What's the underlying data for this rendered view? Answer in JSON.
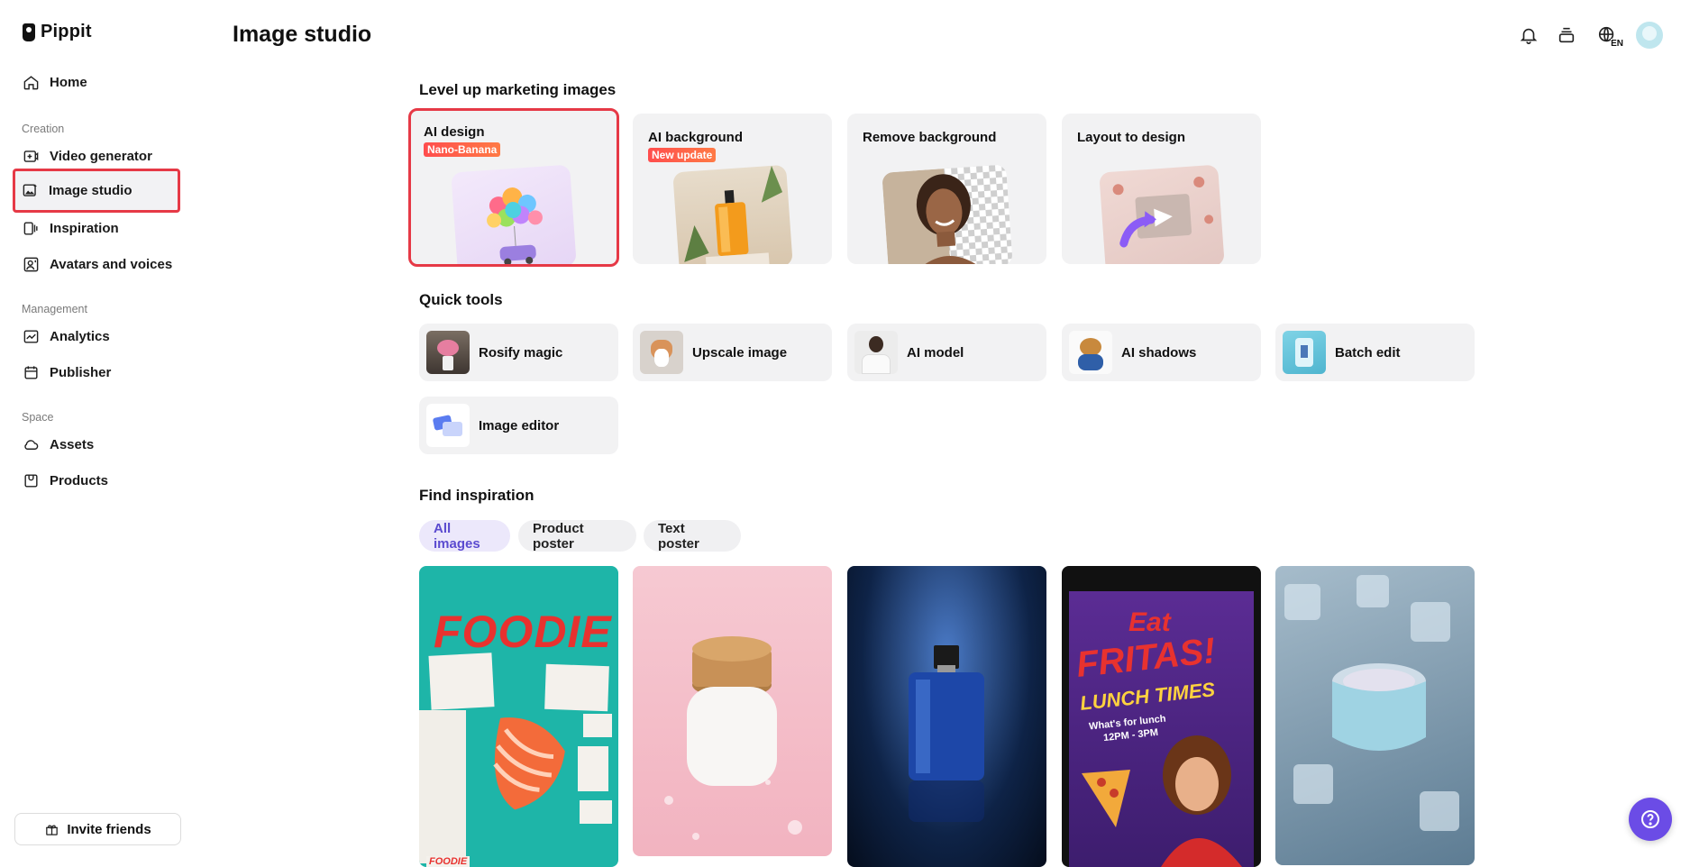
{
  "app": {
    "name": "Pippit",
    "page_title": "Image studio"
  },
  "sidebar": {
    "home": "Home",
    "sections": [
      "Creation",
      "Management",
      "Space"
    ],
    "items": [
      {
        "label": "Video generator"
      },
      {
        "label": "Image studio",
        "active": true
      },
      {
        "label": "Inspiration"
      },
      {
        "label": "Avatars and voices"
      },
      {
        "label": "Analytics"
      },
      {
        "label": "Publisher"
      },
      {
        "label": "Assets"
      },
      {
        "label": "Products"
      }
    ],
    "invite": "Invite friends"
  },
  "header": {
    "language_badge": "EN",
    "icons": [
      "bell-icon",
      "layers-icon",
      "globe-icon",
      "avatar"
    ]
  },
  "marketing": {
    "title": "Level up marketing images",
    "cards": [
      {
        "title": "AI design",
        "badge": "Nano-Banana"
      },
      {
        "title": "AI background",
        "badge": "New update"
      },
      {
        "title": "Remove background"
      },
      {
        "title": "Layout to design"
      }
    ]
  },
  "quick_tools": {
    "title": "Quick tools",
    "items": [
      {
        "label": "Rosify magic"
      },
      {
        "label": "Upscale image"
      },
      {
        "label": "AI model"
      },
      {
        "label": "AI shadows"
      },
      {
        "label": "Batch edit"
      },
      {
        "label": "Image editor"
      }
    ]
  },
  "inspiration": {
    "title": "Find inspiration",
    "filters": [
      "All images",
      "Product poster",
      "Text poster"
    ],
    "active_filter": "All images",
    "posters": {
      "foodie": "FOODIE",
      "foodie_small": "FOODIE",
      "fritas_line1": "Eat",
      "fritas_line2": "FRITAS!",
      "fritas_line3": "LUNCH TIMES",
      "fritas_line4": "What's for lunch",
      "fritas_line5": "12PM - 3PM"
    }
  },
  "colors": {
    "accent": "#6b4ce6",
    "highlight": "#e63946"
  }
}
